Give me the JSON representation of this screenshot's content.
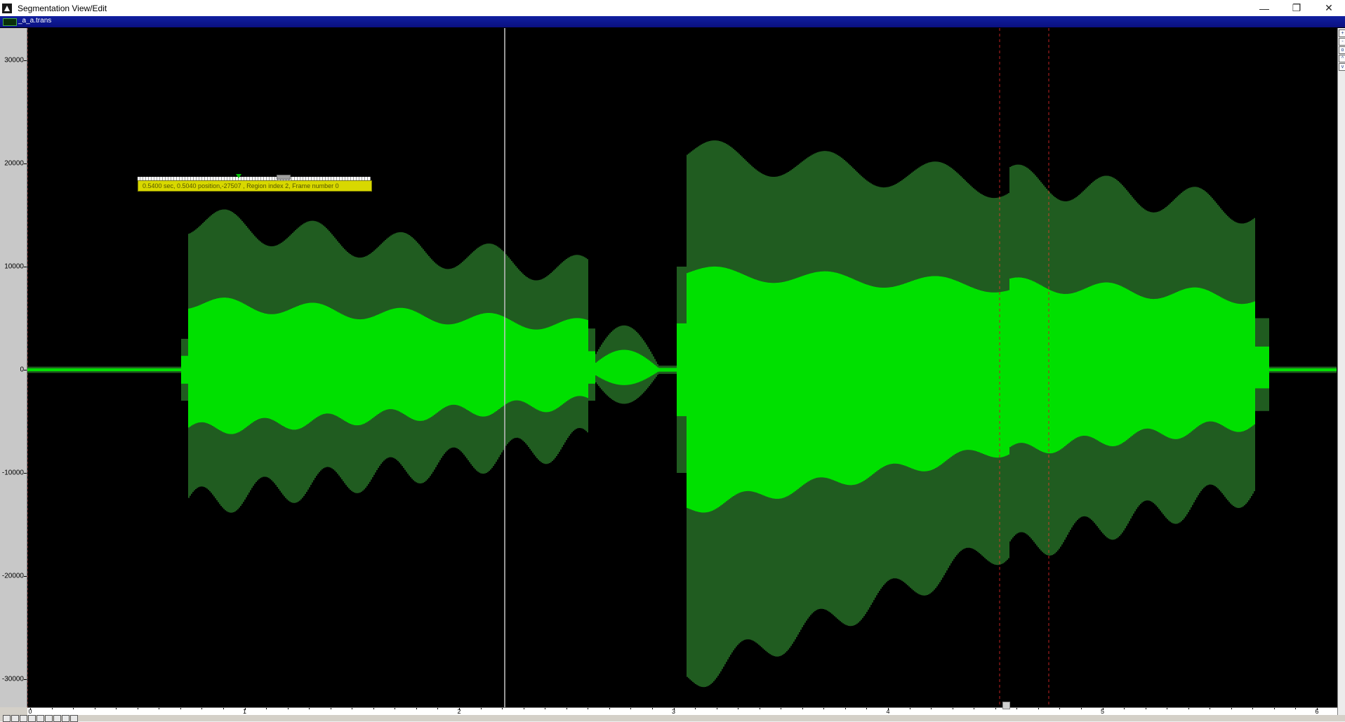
{
  "window": {
    "title": "Segmentation View/Edit",
    "controls": [
      "minimize",
      "restore",
      "close"
    ]
  },
  "document": {
    "tab_title": "_a_a.trans"
  },
  "y_axis": {
    "ticks": [
      "30000",
      "20000",
      "10000",
      "0",
      "-10000",
      "-20000",
      "-30000"
    ],
    "tick_values": [
      30000,
      20000,
      10000,
      0,
      -10000,
      -20000,
      -30000
    ]
  },
  "x_axis": {
    "ticks": [
      "0",
      "1",
      "2",
      "3",
      "4",
      "5",
      "6"
    ]
  },
  "tooltip": {
    "text": "0.5400 sec, 0.5040 position,-27507 , Region index 2, Frame number 0"
  },
  "colors": {
    "waveform_bright": "#00e000",
    "waveform_dark": "#2a7a2a",
    "background": "#000000",
    "cursor": "#c8c8c8",
    "region_marker": "#c02020",
    "title_bar": "#1020a0"
  },
  "icons": [
    "app-icon",
    "minimize-icon",
    "restore-icon",
    "close-icon",
    "zoom-in-icon",
    "zoom-out-icon"
  ]
}
